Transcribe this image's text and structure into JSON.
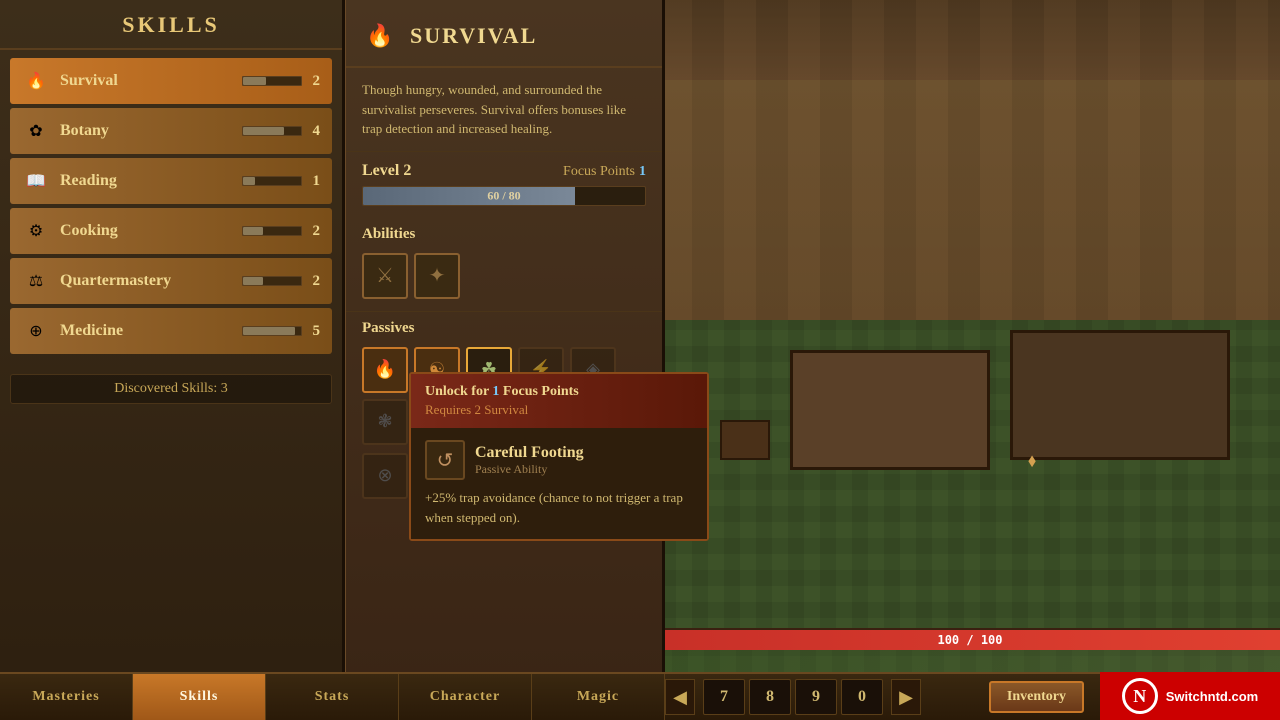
{
  "skills_panel": {
    "title": "Skills",
    "skills": [
      {
        "name": "Survival",
        "level": 2,
        "bar_pct": 40,
        "icon": "🔥",
        "active": true
      },
      {
        "name": "Botany",
        "level": 4,
        "bar_pct": 70,
        "icon": "🌸",
        "active": false
      },
      {
        "name": "Reading",
        "level": 1,
        "bar_pct": 20,
        "icon": "📖",
        "active": false
      },
      {
        "name": "Cooking",
        "level": 2,
        "bar_pct": 35,
        "icon": "⚙",
        "active": false
      },
      {
        "name": "Quartermastery",
        "level": 2,
        "bar_pct": 35,
        "icon": "⚖",
        "active": false
      },
      {
        "name": "Medicine",
        "level": 5,
        "bar_pct": 90,
        "icon": "⊕",
        "active": false
      }
    ],
    "discovered_label": "Discovered Skills: 3"
  },
  "detail_panel": {
    "skill_name": "Survival",
    "skill_icon": "🔥",
    "description": "Though hungry, wounded, and surrounded the survivalist perseveres. Survival offers bonuses like trap detection and increased healing.",
    "level_label": "Level 2",
    "focus_points_label": "Focus Points",
    "focus_points_value": "1",
    "xp_current": 60,
    "xp_max": 80,
    "xp_label": "60 / 80",
    "abilities_label": "Abilities",
    "passives_label": "Passives"
  },
  "tooltip": {
    "unlock_text": "Unlock for ",
    "unlock_cost": "1",
    "unlock_suffix": " Focus Points",
    "requires_text": "Requires 2 Survival",
    "ability_name": "Careful Footing",
    "ability_type": "Passive Ability",
    "ability_icon": "↩",
    "effect_text": "+25% trap avoidance (chance to not trigger a trap when stepped on)."
  },
  "bottom_nav": {
    "tabs": [
      "Masteries",
      "Skills",
      "Stats",
      "Character",
      "Magic"
    ]
  },
  "hud": {
    "hp_current": 100,
    "hp_max": 100,
    "hp_label": "100 / 100",
    "numbers": [
      "7",
      "8",
      "9",
      "0"
    ],
    "inventory_label": "Inventory"
  },
  "nintendo": {
    "logo_text": "N",
    "site_text": "Switchntd.com"
  }
}
